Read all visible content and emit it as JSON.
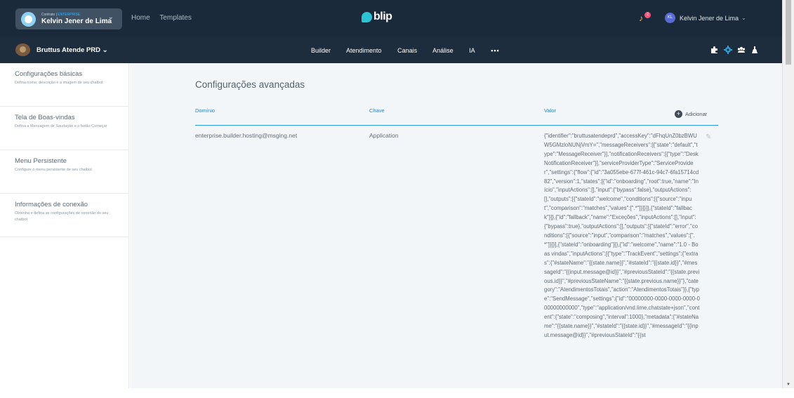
{
  "topbar": {
    "contract_label": "Contrato |",
    "contract_tier": "ENTERPRISE",
    "contract_name": "Kelvin Jener de Lima",
    "nav": [
      "Home",
      "Templates"
    ],
    "logo_text": "blip",
    "notification_count": "2",
    "user_initials": "KL",
    "user_name": "Kelvin Jener de Lima"
  },
  "botbar": {
    "bot_name": "Bruttus Atende PRD",
    "tabs": [
      "Builder",
      "Atendimento",
      "Canais",
      "Análise",
      "IA"
    ],
    "more": "•••",
    "icons": [
      "puzzle-icon",
      "gear-icon",
      "team-icon",
      "flask-icon"
    ],
    "icon_colors": {
      "puzzle": "#ffffff",
      "gear": "#2f9fd7",
      "team": "#ffffff",
      "flask": "#ffffff"
    }
  },
  "sidebar": {
    "items": [
      {
        "title": "Configurações básicas",
        "desc": "Defina nome, descrição e a imagem de seu chatbot"
      },
      {
        "title": "Tela de Boas-vindas",
        "desc": "Defina a Mensagem de Saudação e o botão Começar"
      },
      {
        "title": "Menu Persistente",
        "desc": "Configure o menu persistente de seu chatbot"
      },
      {
        "title": "Informações de conexão",
        "desc": "Obtenha e defina as configurações de conexão do seu chatbot"
      }
    ]
  },
  "main": {
    "title": "Configurações avançadas",
    "columns": {
      "domain": "Domínio",
      "key": "Chave",
      "value": "Valor"
    },
    "add_label": "Adicionar",
    "row": {
      "domain": "enterprise.builder.hosting@msging.net",
      "key": "Application",
      "value": "{\"identifier\":\"bruttusatendeprd\",\"accessKey\":\"dFhqUnZ0bzBWUW5GMzloNUNjVmY=\",\"messageReceivers\":[{\"state\":\"default\",\"type\":\"MessageReceiver\"}],\"notificationReceivers\":[{\"type\":\"DeskNotificationReceiver\"}],\"serviceProviderType\":\"ServiceProvider\",\"settings\":{\"flow\":{\"id\":\"3a055ebe-677f-461c-94c7-6fa15714cd82\",\"version\":1,\"states\":[{\"id\":\"onboarding\",\"root\":true,\"name\":\"Início\",\"inputActions\":[],\"input\":{\"bypass\":false},\"outputActions\":[],\"outputs\":[{\"stateId\":\"welcome\",\"conditions\":[{\"source\":\"input\",\"comparison\":\"matches\",\"values\":[\".*\"]}]}]},{\"stateId\":\"fallback\"}]},{\"id\":\"fallback\",\"name\":\"Exceções\",\"inputActions\":[],\"input\":{\"bypass\":true},\"outputActions\":[],\"outputs\":[{\"stateId\":\"error\",\"conditions\":[{\"source\":\"input\",\"comparison\":\"matches\",\"values\":[\".*\"]}]}],{\"stateId\":\"onboarding\"}]},{\"id\":\"welcome\",\"name\":\"1.0 - Boas vindas\",\"inputActions\":[{\"type\":\"TrackEvent\",\"settings\":{\"extras\":{\"#stateName\":\"{{state.name}}\",\"#stateId\":\"{{state.id}}\",\"#messageId\":\"{{input.message@id}}\",\"#previousStateId\":\"{{state.previous.id}}\",\"#previousStateName\":\"{{state.previous.name}}\"},\"category\":\"AtendimentosTotais\",\"action\":\"AtendimentosTotais\"}},{\"type\":\"SendMessage\",\"settings\":{\"id\":\"00000000-0000-0000-0000-000000000000\",\"type\":\"application/vnd.lime.chatstate+json\",\"content\":{\"state\":\"composing\",\"interval\":1000},\"metadata\":{\"#stateName\":\"{{state.name}}\",\"#stateId\":\"{{state.id}}\",\"#messageId\":\"{{input.message@id}}\",\"#previousStateId\":\"{{st"
    }
  }
}
